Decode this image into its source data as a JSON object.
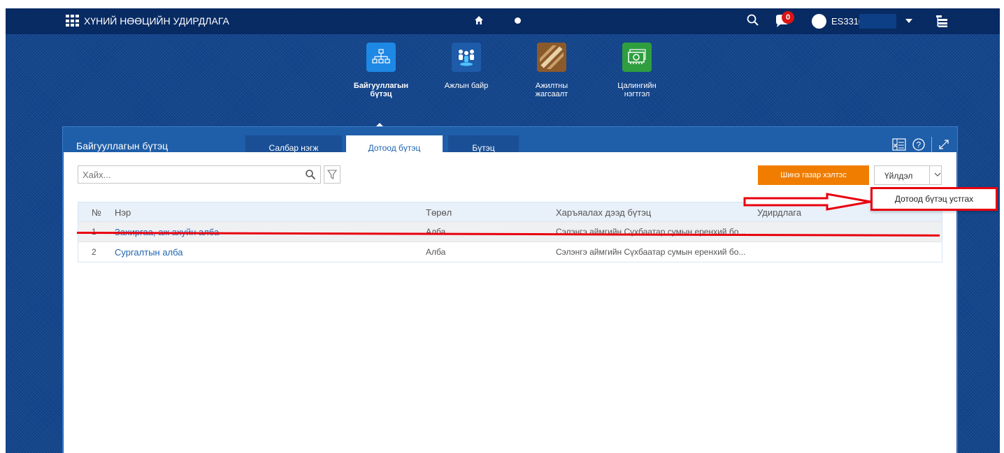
{
  "header": {
    "app_title": "ХҮНИЙ НӨӨЦИЙН УДИРДЛАГА",
    "notification_count": "0",
    "user_name": "ES3310"
  },
  "tiles": [
    {
      "label": "Байгууллагын\nбүтэц",
      "icon": "org-structure-icon",
      "color": "#1e88e5"
    },
    {
      "label": "Ажлын байр",
      "icon": "workplace-people-icon",
      "color": "#1e5ba8"
    },
    {
      "label": "Ажилтны\nжагсаалт",
      "icon": "employee-list-icon",
      "color": "#8b5a2b"
    },
    {
      "label": "Цалингийн\nнэгтгэл",
      "icon": "salary-money-icon",
      "color": "#2e9e3e"
    }
  ],
  "panel": {
    "title": "Байгууллагын бүтэц",
    "tabs": [
      "Салбар нэгж",
      "Дотоод бүтэц",
      "Бүтэц"
    ],
    "active_tab": "Дотоод бүтэц"
  },
  "toolbar": {
    "search_placeholder": "Хайх...",
    "new_button_label": "Шинэ газар хэлтэс",
    "action_label": "Үйлдэл"
  },
  "table": {
    "headers": {
      "num": "№",
      "name": "Нэр",
      "type": "Төрөл",
      "parent": "Харъяалах дээд бүтэц",
      "head": "Удирдлага"
    },
    "rows": [
      {
        "num": "1",
        "name": "Захиргаа, аж ахуйн алба",
        "type": "Алба",
        "parent": "Сэлэнгэ аймгийн Сүхбаатар сумын еренхий бо..."
      },
      {
        "num": "2",
        "name": "Сургалтын алба",
        "type": "Алба",
        "parent": "Сэлэнгэ аймгийн Сүхбаатар сумын еренхий бо..."
      }
    ]
  },
  "dropdown": {
    "item": "Дотоод бүтэц устгах"
  },
  "colors": {
    "shell_bg": "#0d3f86",
    "panel_bg": "#1f5ea8",
    "accent": "#1f64b0",
    "orange": "#f07d00",
    "annotation_red": "#e8000e"
  }
}
